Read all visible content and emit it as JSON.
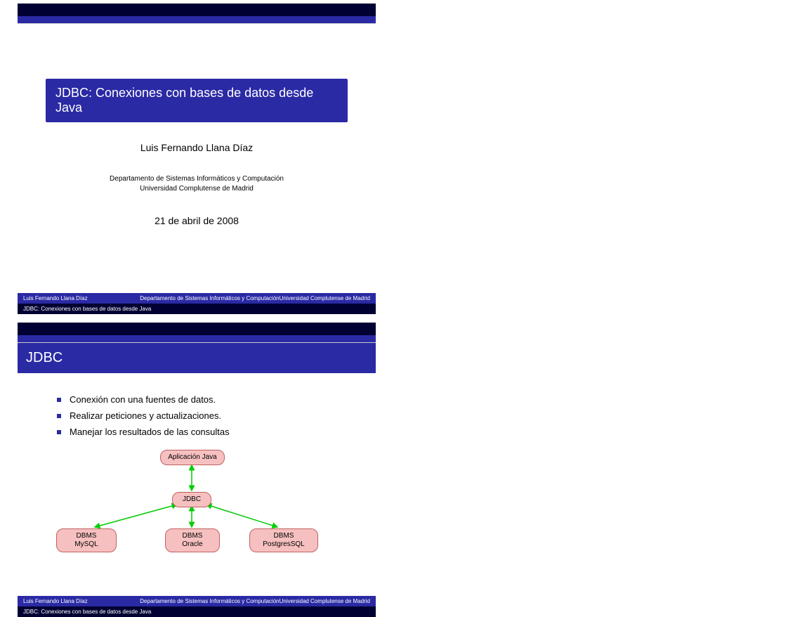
{
  "slide1": {
    "title": "JDBC: Conexiones con bases de datos desde Java",
    "author": "Luis Fernando Llana Díaz",
    "dept_line1": "Departamento de Sistemas Informáticos y Computación",
    "dept_line2": "Universidad Complutense de Madrid",
    "date": "21 de abril de 2008"
  },
  "slide2": {
    "heading": "JDBC",
    "bullets": [
      "Conexión con una fuentes de datos.",
      "Realizar peticiones y actualizaciones.",
      "Manejar los resultados de las consultas"
    ],
    "diagram": {
      "app": "Aplicación Java",
      "jdbc": "JDBC",
      "mysql_l1": "DBMS",
      "mysql_l2": "MySQL",
      "oracle_l1": "DBMS",
      "oracle_l2": "Oracle",
      "pg_l1": "DBMS",
      "pg_l2": "PostgresSQL"
    }
  },
  "footer": {
    "author": "Luis Fernando Llana Díaz",
    "dept": "Departamento de Sistemas Informáticos y ComputaciónUniversidad Complutense de Madrid",
    "title": "JDBC: Conexiones con bases de datos desde Java"
  }
}
